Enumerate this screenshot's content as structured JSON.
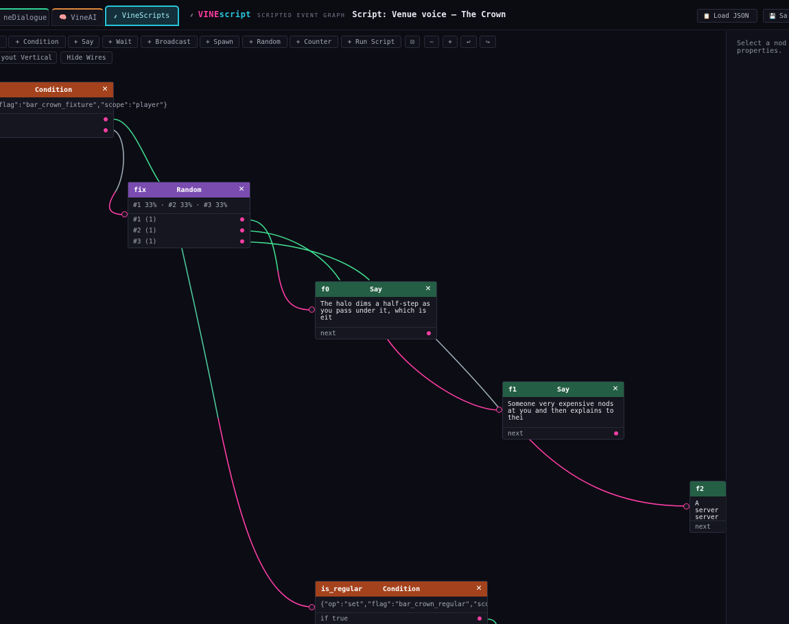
{
  "tabs": [
    {
      "label": "neDialogue",
      "icon": "",
      "color": "#2fd49a"
    },
    {
      "label": "VineAI",
      "icon": "🧠",
      "color": "#e08a3c"
    },
    {
      "label": "VineScripts",
      "icon": "⸙",
      "color": "#27c5d9"
    }
  ],
  "brand": {
    "icon": "⸙",
    "part1": "VINE",
    "part2": "script",
    "subtitle": "SCRIPTED EVENT GRAPH",
    "script_title": "Script: Venue voice — The Crown"
  },
  "top_actions": {
    "load_json": "Load JSON",
    "load_icon": "📋",
    "save_icon": "💾",
    "save": "Sa"
  },
  "toolbar": {
    "row1": [
      "+ Condition",
      "+ Say",
      "+ Wait",
      "+ Broadcast",
      "+ Spawn",
      "+ Random",
      "+ Counter",
      "+ Run Script"
    ],
    "fit": "⊡",
    "zoom_out": "−",
    "zoom_in": "+",
    "undo": "↩",
    "redo": "↪",
    "row2": [
      "yout Vertical",
      "Hide Wires"
    ]
  },
  "right_panel": {
    "hint": "Select a nod\nproperties."
  },
  "nodes": {
    "cond_top": {
      "id": "",
      "type": "Condition",
      "summary": "flag\":\"bar_crown_fixture\",\"scope\":\"player\"}",
      "close": "✕"
    },
    "fix": {
      "id": "fix",
      "type": "Random",
      "summary": "#1 33% · #2 33% · #3 33%",
      "ports": [
        "#1 (1)",
        "#2 (1)",
        "#3 (1)"
      ],
      "close": "✕"
    },
    "f0": {
      "id": "f0",
      "type": "Say",
      "text": "The halo dims a half-step as you pass under it, which is eit",
      "port": "next",
      "close": "✕"
    },
    "f1": {
      "id": "f1",
      "type": "Say",
      "text": "Someone very expensive nods at you and then explains to thei",
      "port": "next",
      "close": "✕"
    },
    "f2": {
      "id": "f2",
      "type": "Say",
      "text": "A server server r",
      "port": "next",
      "close": "✕"
    },
    "is_regular": {
      "id": "is_regular",
      "type": "Condition",
      "summary": "{\"op\":\"set\",\"flag\":\"bar_crown_regular\",\"scope\":\"player\"}",
      "port": "if true",
      "close": "✕"
    }
  }
}
